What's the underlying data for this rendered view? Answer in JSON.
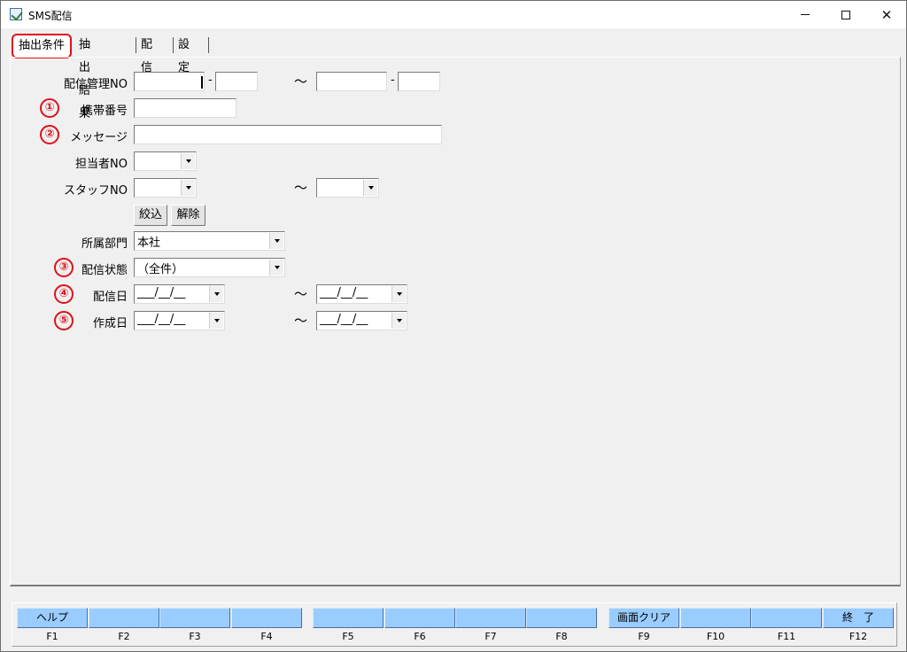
{
  "window": {
    "title": "SMS配信",
    "icon": "app-icon"
  },
  "tabs": [
    {
      "label": "抽出条件",
      "active": true
    },
    {
      "label": "抽出結果",
      "active": false
    },
    {
      "label": "配信",
      "active": false
    },
    {
      "label": "設定",
      "active": false
    }
  ],
  "form": {
    "delivery_no": {
      "label": "配信管理NO",
      "from_a": "",
      "from_b": "",
      "to_a": "",
      "to_b": "",
      "dash": "-",
      "tilde": "～"
    },
    "mobile": {
      "marker": "①",
      "label": "携帯番号",
      "value": ""
    },
    "message": {
      "marker": "②",
      "label": "メッセージ",
      "value": ""
    },
    "staff_in_charge": {
      "label": "担当者NO",
      "value": ""
    },
    "staff_no": {
      "label": "スタッフNO",
      "from": "",
      "to": "",
      "tilde": "～"
    },
    "buttons": {
      "filter": "絞込",
      "clear": "解除"
    },
    "department": {
      "label": "所属部門",
      "value": "本社"
    },
    "status": {
      "marker": "③",
      "label": "配信状態",
      "value": "（全件）"
    },
    "delivery_date": {
      "marker": "④",
      "label": "配信日",
      "from": "___/__/__",
      "to": "___/__/__",
      "tilde": "～"
    },
    "created_date": {
      "marker": "⑤",
      "label": "作成日",
      "from": "___/__/__",
      "to": "___/__/__",
      "tilde": "～"
    }
  },
  "function_keys": [
    {
      "label": "ヘルプ",
      "key": "F1"
    },
    {
      "label": "",
      "key": "F2"
    },
    {
      "label": "",
      "key": "F3"
    },
    {
      "label": "",
      "key": "F4"
    },
    {
      "label": "",
      "key": "F5"
    },
    {
      "label": "",
      "key": "F6"
    },
    {
      "label": "",
      "key": "F7"
    },
    {
      "label": "",
      "key": "F8"
    },
    {
      "label": "画面クリア",
      "key": "F9"
    },
    {
      "label": "",
      "key": "F10"
    },
    {
      "label": "",
      "key": "F11"
    },
    {
      "label": "終　了",
      "key": "F12"
    }
  ],
  "colors": {
    "marker": "#e0101b",
    "fkey": "#99ccff",
    "background": "#f0f0f0"
  }
}
